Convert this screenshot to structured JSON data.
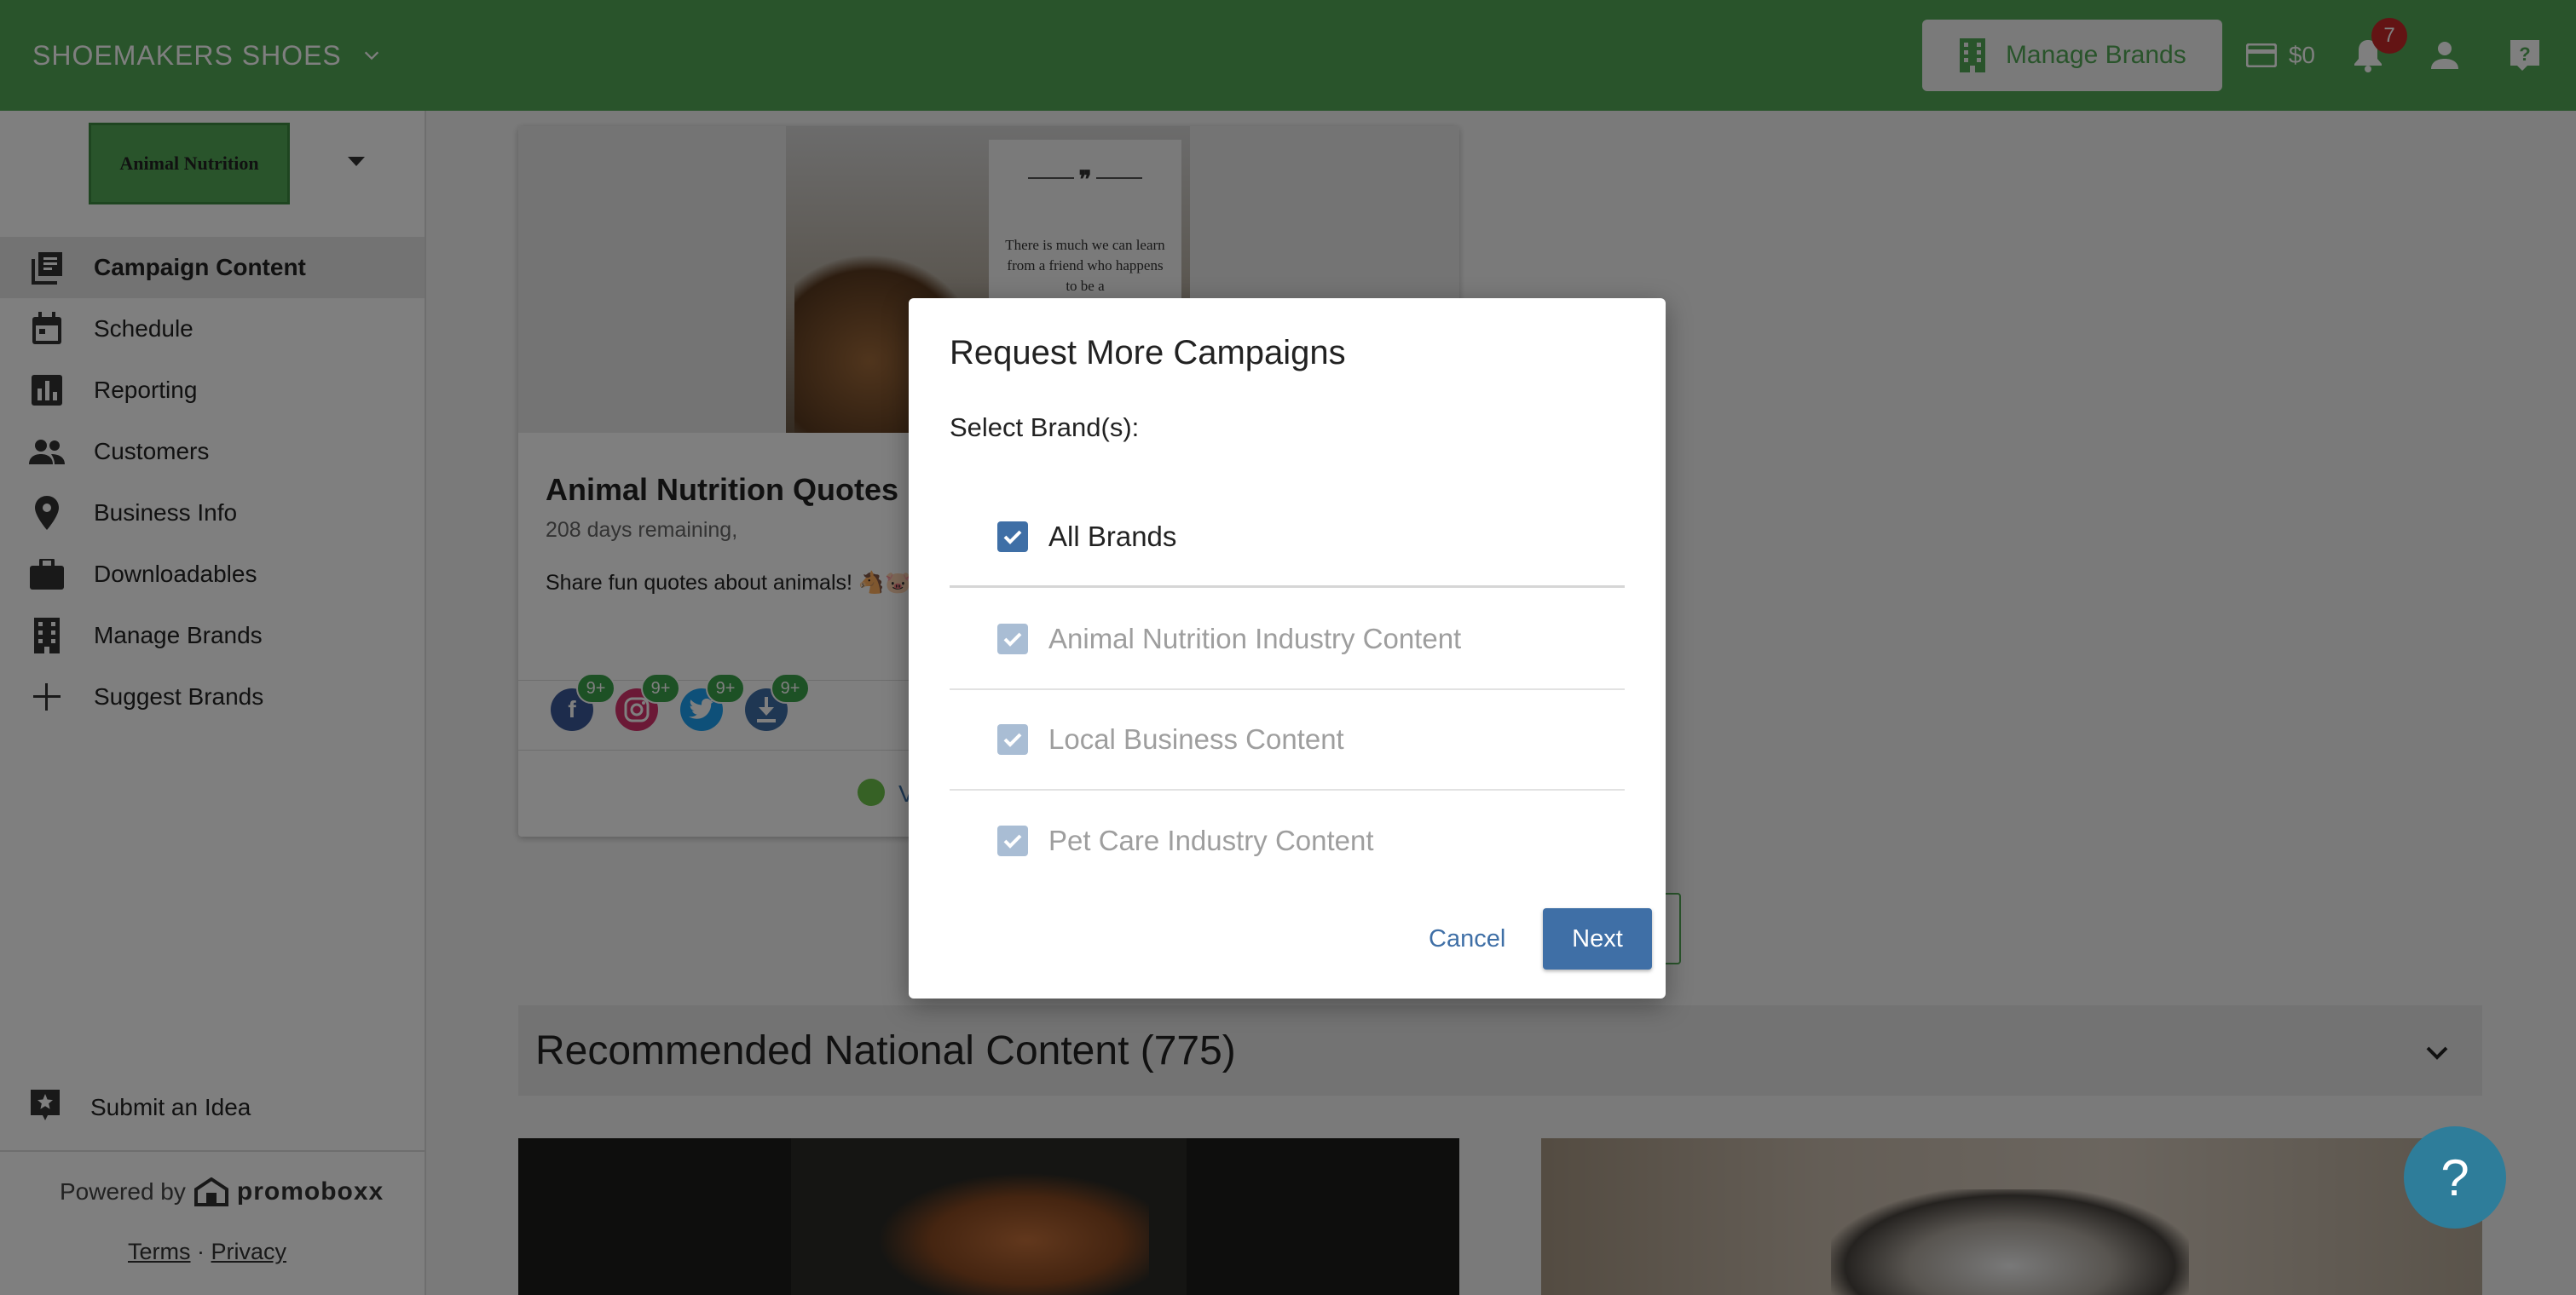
{
  "topbar": {
    "org_name": "SHOEMAKERS SHOES",
    "manage_brands_label": "Manage Brands",
    "credit": "$0",
    "notification_count": "7"
  },
  "sidebar": {
    "brand_name": "Animal Nutrition",
    "items": [
      {
        "label": "Campaign Content",
        "icon": "book-icon",
        "active": true
      },
      {
        "label": "Schedule",
        "icon": "calendar-icon"
      },
      {
        "label": "Reporting",
        "icon": "bar-chart-icon"
      },
      {
        "label": "Customers",
        "icon": "people-icon"
      },
      {
        "label": "Business Info",
        "icon": "location-pin-icon"
      },
      {
        "label": "Downloadables",
        "icon": "briefcase-icon"
      },
      {
        "label": "Manage Brands",
        "icon": "building-icon"
      },
      {
        "label": "Suggest Brands",
        "icon": "plus-icon"
      }
    ],
    "submit_idea": "Submit an Idea",
    "powered_by": "Powered by",
    "powered_logo": "promoboxx",
    "terms": "Terms",
    "legal_sep": "·",
    "privacy": "Privacy"
  },
  "card": {
    "title": "Animal Nutrition Quotes",
    "days_remaining": "208 days remaining,",
    "description": "Share fun quotes about animals! 🐴🐷",
    "quote_text": "There is much we can learn from a friend who happens to be a",
    "quote_mark": "❞",
    "social_counts": [
      "9+",
      "9+",
      "9+",
      "9+"
    ],
    "status_text": "V"
  },
  "section": {
    "title": "Recommended National Content (775)"
  },
  "help_fab": "?",
  "modal": {
    "title": "Request More Campaigns",
    "subtitle": "Select Brand(s):",
    "options": [
      {
        "label": "All Brands",
        "checked": true,
        "disabled": false
      },
      {
        "label": "Animal Nutrition Industry Content",
        "checked": true,
        "disabled": true
      },
      {
        "label": "Local Business Content",
        "checked": true,
        "disabled": true
      },
      {
        "label": "Pet Care Industry Content",
        "checked": true,
        "disabled": true
      }
    ],
    "cancel_label": "Cancel",
    "next_label": "Next"
  },
  "colors": {
    "brand_green": "#52a956",
    "primary_blue": "#3f6fa6",
    "badge_red": "#c62828"
  }
}
